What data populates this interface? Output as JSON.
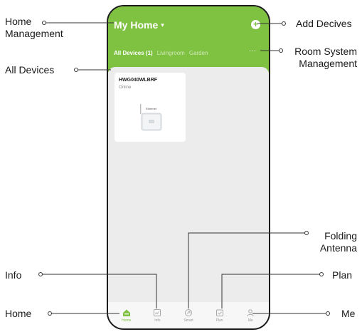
{
  "app": {
    "home_name": "My Home",
    "home_caret": "▾",
    "add_icon": "+",
    "more_icon": "···"
  },
  "tabs": [
    {
      "label": "All Devices (1)",
      "active": true
    },
    {
      "label": "Livingroom",
      "active": false
    },
    {
      "label": "Garden",
      "active": false
    }
  ],
  "device": {
    "name": "HWG040WLBRF",
    "status": "Online",
    "port_label": "Ethernet"
  },
  "nav": [
    {
      "label": "Home",
      "icon": "home-icon",
      "active": true
    },
    {
      "label": "Info",
      "icon": "info-icon",
      "active": false
    },
    {
      "label": "Smart",
      "icon": "smart-icon",
      "active": false
    },
    {
      "label": "Plan",
      "icon": "plan-icon",
      "active": false
    },
    {
      "label": "Me",
      "icon": "person-icon",
      "active": false
    }
  ],
  "callouts": {
    "home_management_1": "Home",
    "home_management_2": "Management",
    "add_devices": "Add Decives",
    "room_system_1": "Room System",
    "room_system_2": "Management",
    "all_devices": "All Devices",
    "folding_antenna_1": "Folding",
    "folding_antenna_2": "Antenna",
    "info": "Info",
    "plan": "Plan",
    "home": "Home",
    "me": "Me"
  },
  "colors": {
    "accent": "#7fc141",
    "background": "#ececec"
  }
}
